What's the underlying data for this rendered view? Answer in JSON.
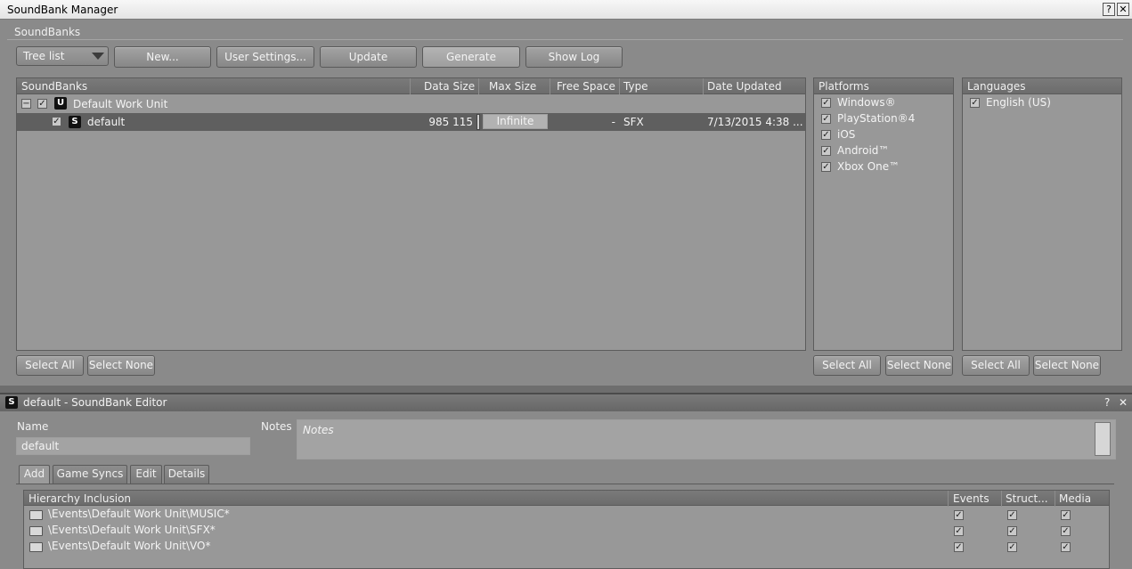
{
  "window": {
    "title": "SoundBank Manager",
    "help": "?",
    "close": "✕"
  },
  "soundbanks_section": {
    "label": "SoundBanks"
  },
  "toolbar": {
    "view_mode": "Tree list",
    "new_label": "New...",
    "user_settings_label": "User Settings...",
    "update_label": "Update",
    "generate_label": "Generate",
    "show_log_label": "Show Log"
  },
  "soundbank_table": {
    "columns": [
      "SoundBanks",
      "Data Size",
      "Max Size",
      "Free Space",
      "Type",
      "Date Updated"
    ],
    "work_unit": {
      "expander": "−",
      "name": "Default Work Unit",
      "icon": "U"
    },
    "rows": [
      {
        "name": "default",
        "icon": "S",
        "data_size": "985 115",
        "max_size": "Infinite",
        "free_space": "-",
        "type": "SFX",
        "date_updated": "7/13/2015 4:38 ..."
      }
    ],
    "select_all": "Select All",
    "select_none": "Select None"
  },
  "platforms": {
    "header": "Platforms",
    "items": [
      "Windows®",
      "PlayStation®4",
      "iOS",
      "Android™",
      "Xbox One™"
    ],
    "select_all": "Select All",
    "select_none": "Select None"
  },
  "languages": {
    "header": "Languages",
    "items": [
      "English (US)"
    ],
    "select_all": "Select All",
    "select_none": "Select None"
  },
  "editor": {
    "title": "default - SoundBank Editor",
    "icon": "S",
    "help": "?",
    "close": "✕",
    "name_label": "Name",
    "name_value": "default",
    "notes_label": "Notes",
    "notes_placeholder": "Notes",
    "tabs": [
      "Add",
      "Game Syncs",
      "Edit",
      "Details"
    ],
    "table": {
      "columns": [
        "Hierarchy Inclusion",
        "Events",
        "Struct...",
        "Media"
      ],
      "rows": [
        {
          "path": "\\Events\\Default Work Unit\\MUSIC*"
        },
        {
          "path": "\\Events\\Default Work Unit\\SFX*"
        },
        {
          "path": "\\Events\\Default Work Unit\\VO*"
        }
      ]
    }
  },
  "colors": {
    "background": "#8a8a8a",
    "selected_row": "#5f5f5f",
    "header": "#6c6c6c"
  }
}
